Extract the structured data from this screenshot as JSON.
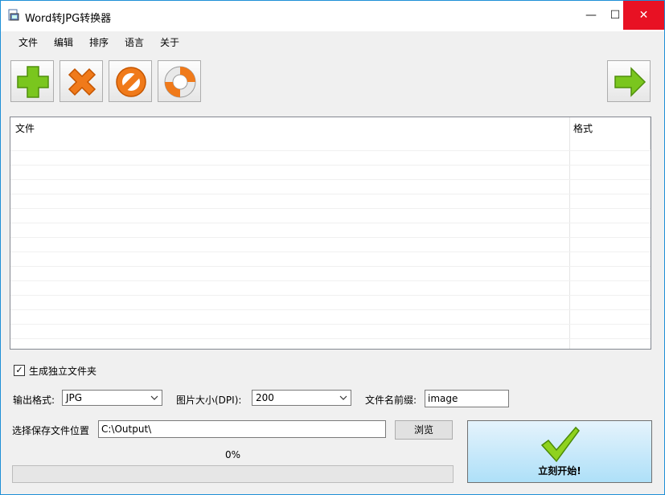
{
  "window": {
    "title": "Word转JPG转换器",
    "min_symbol": "—",
    "max_symbol": "☐",
    "close_symbol": "✕"
  },
  "menu": [
    "文件",
    "编辑",
    "排序",
    "语言",
    "关于"
  ],
  "toolbar": {
    "icons": [
      "add-icon",
      "remove-icon",
      "clear-icon",
      "help-icon",
      "next-icon"
    ]
  },
  "filelist": {
    "columns": [
      "文件",
      "格式"
    ],
    "rows": []
  },
  "options": {
    "separate_folder_label": "生成独立文件夹",
    "separate_folder_checked": true,
    "output_format_label": "输出格式:",
    "output_format_value": "JPG",
    "dpi_label": "图片大小(DPI):",
    "dpi_value": "200",
    "prefix_label": "文件名前缀:",
    "prefix_value": "image"
  },
  "save": {
    "label": "选择保存文件位置",
    "path": "C:\\Output\\",
    "browse_label": "浏览"
  },
  "progress": {
    "text": "0%",
    "value": 0
  },
  "start": {
    "label": "立刻开始!"
  },
  "colors": {
    "accent": "#1e8fd6",
    "close": "#e81123"
  }
}
